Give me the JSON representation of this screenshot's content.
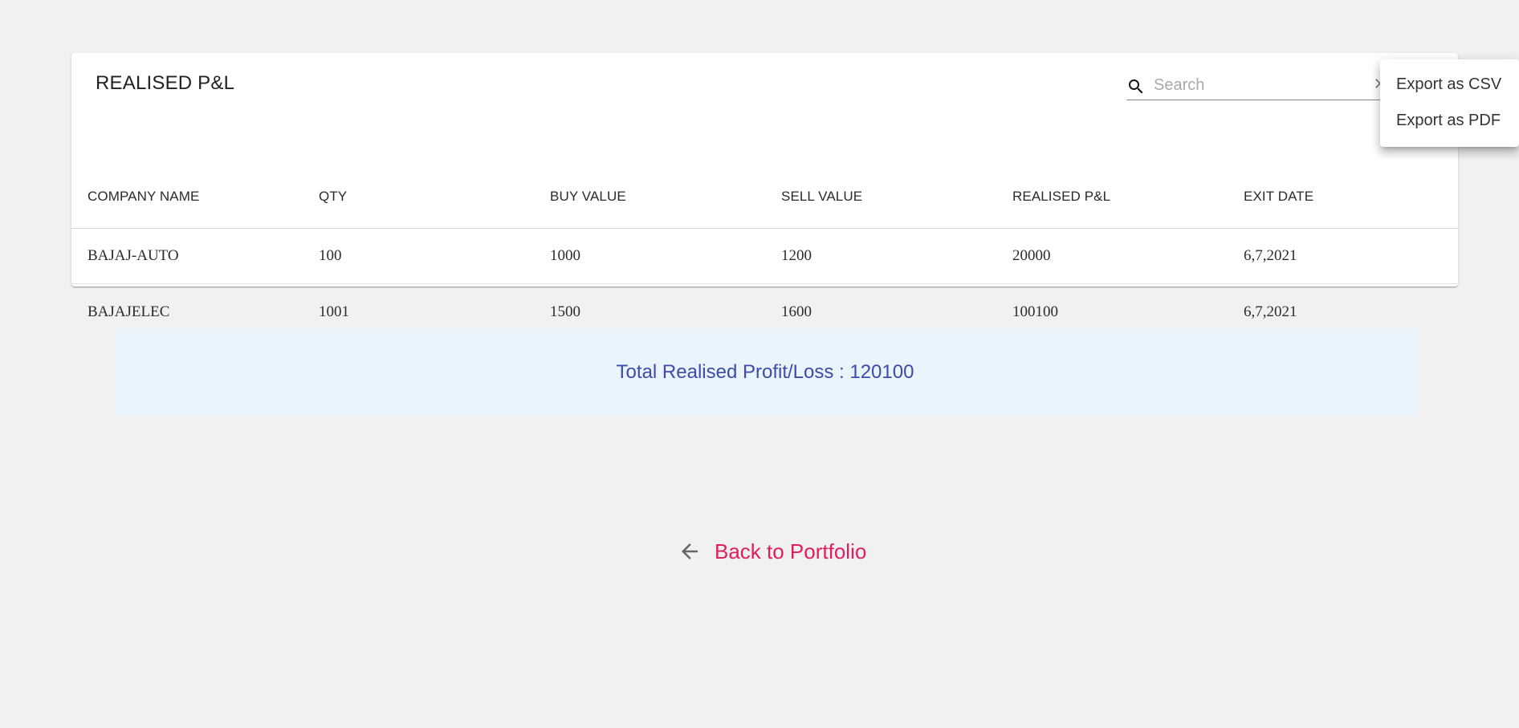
{
  "table": {
    "title": "REALISED P&L",
    "search": {
      "placeholder": "Search",
      "value": ""
    },
    "columns": [
      "COMPANY NAME",
      "QTY",
      "BUY VALUE",
      "SELL VALUE",
      "REALISED P&L",
      "EXIT DATE"
    ],
    "rows": [
      [
        "BAJAJ-AUTO",
        "100",
        "1000",
        "1200",
        "20000",
        "6,7,2021"
      ],
      [
        "BAJAJELEC",
        "1001",
        "1500",
        "1600",
        "100100",
        "6,7,2021"
      ]
    ]
  },
  "export_menu": {
    "items": [
      {
        "label": "Export as CSV"
      },
      {
        "label": "Export as PDF"
      }
    ]
  },
  "summary": {
    "total_text": "Total Realised Profit/Loss : 120100"
  },
  "navigation": {
    "back_label": "Back to Portfolio",
    "back_icon": "arrow-left-icon"
  },
  "colors": {
    "page_background": "#f1f1f1",
    "total_text": "#3b4caa",
    "total_background": "#eaf4fc",
    "back_link": "#e11d5d"
  },
  "icons": {
    "search": "search-icon",
    "clear": "close-icon",
    "back": "arrow-left-icon"
  }
}
